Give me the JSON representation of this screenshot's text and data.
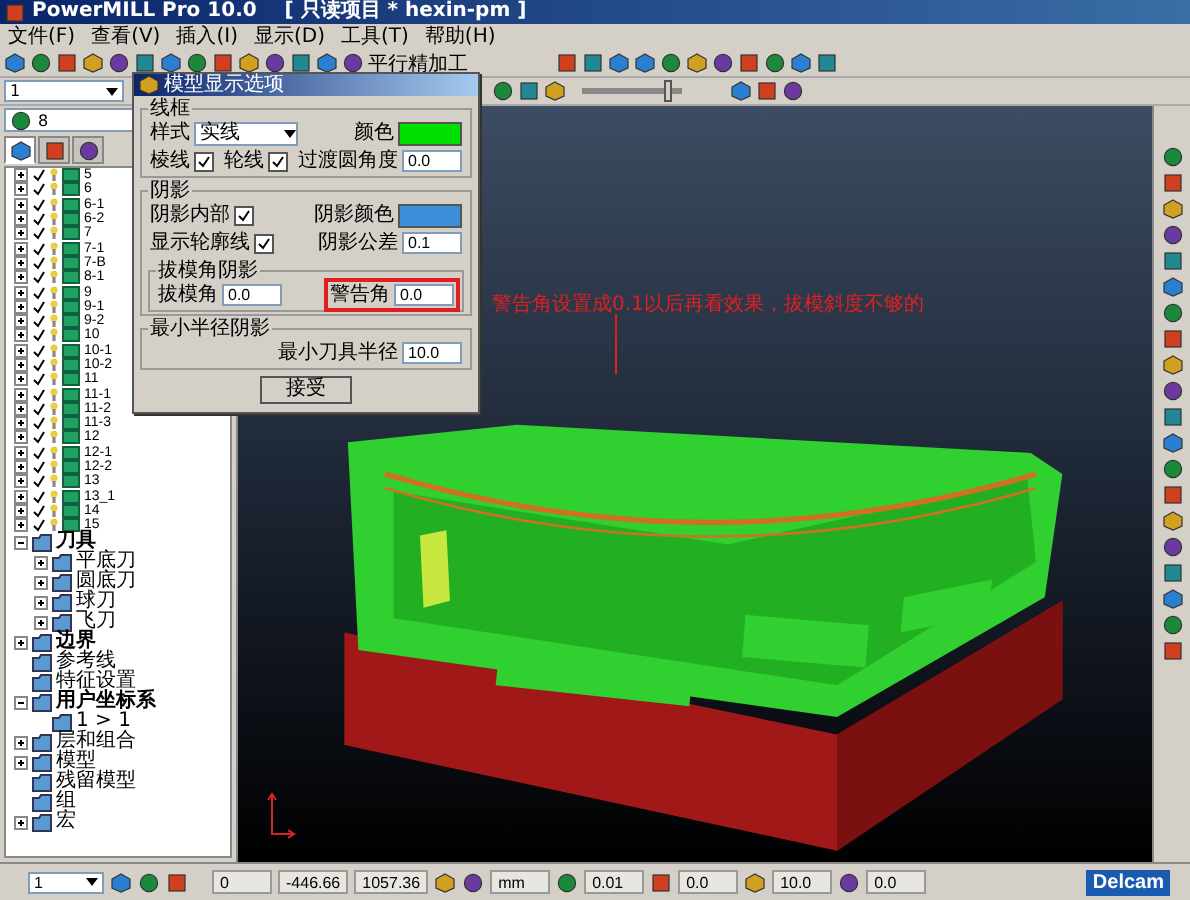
{
  "window": {
    "title": "PowerMILL Pro 10.0    [ 只读项目 * hexin-pm ]"
  },
  "menu": [
    "文件(F)",
    "查看(V)",
    "插入(I)",
    "显示(D)",
    "工具(T)",
    "帮助(H)"
  ],
  "toolbar": {
    "strategy_button": "平行精加工"
  },
  "toolbar2": {
    "dropdown": "1",
    "slider": {
      "level": 0.9
    }
  },
  "explorer": {
    "search_value": "8",
    "tabs": [
      {
        "selected": true
      },
      {
        "selected": false
      },
      {
        "selected": false
      }
    ],
    "tree": [
      {
        "kind": "part",
        "label": "5",
        "checked": true
      },
      {
        "kind": "part",
        "label": "6",
        "checked": true
      },
      {
        "kind": "part",
        "label": "6-1",
        "checked": true
      },
      {
        "kind": "part",
        "label": "6-2",
        "checked": true
      },
      {
        "kind": "part",
        "label": "7",
        "checked": true
      },
      {
        "kind": "part",
        "label": "7-1",
        "checked": true
      },
      {
        "kind": "part",
        "label": "7-B",
        "checked": true
      },
      {
        "kind": "part",
        "label": "8-1",
        "checked": true
      },
      {
        "kind": "part",
        "label": "9",
        "checked": true
      },
      {
        "kind": "part",
        "label": "9-1",
        "checked": true
      },
      {
        "kind": "part",
        "label": "9-2",
        "checked": true
      },
      {
        "kind": "part",
        "label": "10",
        "checked": true
      },
      {
        "kind": "part",
        "label": "10-1",
        "checked": true
      },
      {
        "kind": "part",
        "label": "10-2",
        "checked": true
      },
      {
        "kind": "part",
        "label": "11",
        "checked": true
      },
      {
        "kind": "part",
        "label": "11-1",
        "checked": true
      },
      {
        "kind": "part",
        "label": "11-2",
        "checked": true
      },
      {
        "kind": "part",
        "label": "11-3",
        "checked": true
      },
      {
        "kind": "part",
        "label": "12",
        "checked": true
      },
      {
        "kind": "part",
        "label": "12-1",
        "checked": true
      },
      {
        "kind": "part",
        "label": "12-2",
        "checked": true
      },
      {
        "kind": "part",
        "label": "13",
        "checked": true
      },
      {
        "kind": "part",
        "label": "13_1",
        "checked": true
      },
      {
        "kind": "part",
        "label": "14",
        "checked": true
      },
      {
        "kind": "part",
        "label": "15",
        "checked": true
      },
      {
        "kind": "folder",
        "label": "刀具",
        "bold": true,
        "expanded": true,
        "children": [
          {
            "kind": "folder",
            "label": "平底刀",
            "bold": false,
            "expanded": false
          },
          {
            "kind": "folder",
            "label": "圆底刀",
            "bold": false,
            "expanded": false
          },
          {
            "kind": "folder",
            "label": "球刀",
            "bold": false,
            "expanded": false
          },
          {
            "kind": "folder",
            "label": "飞刀",
            "bold": false,
            "expanded": false
          }
        ]
      },
      {
        "kind": "folder",
        "label": "边界",
        "bold": true,
        "expanded": false
      },
      {
        "kind": "leaf",
        "label": "参考线",
        "bold": false
      },
      {
        "kind": "leaf",
        "label": "特征设置",
        "bold": false
      },
      {
        "kind": "folder",
        "label": "用户坐标系",
        "bold": true,
        "expanded": true,
        "children": [
          {
            "kind": "leaf",
            "label": "1 > 1",
            "bold": false
          }
        ]
      },
      {
        "kind": "folder",
        "label": "层和组合",
        "bold": false,
        "expanded": false
      },
      {
        "kind": "folder",
        "label": "模型",
        "bold": false,
        "expanded": false
      },
      {
        "kind": "leaf",
        "label": "残留模型",
        "bold": false
      },
      {
        "kind": "leaf",
        "label": "组",
        "bold": false
      },
      {
        "kind": "folder",
        "label": "宏",
        "bold": false,
        "expanded": false
      }
    ]
  },
  "dialog": {
    "title": "模型显示选项",
    "groups": [
      {
        "title": "线框",
        "rows": [
          [
            {
              "kind": "select",
              "label": "样式",
              "value": "实线"
            },
            "",
            {
              "kind": "color",
              "label": "颜色",
              "color": "#00e000"
            }
          ],
          [
            {
              "kind": "check",
              "label": "棱线",
              "checked": true
            },
            {
              "kind": "check",
              "label": "轮线",
              "checked": true
            },
            {
              "kind": "number",
              "label": "过渡圆角度",
              "value": "0.0",
              "highlighted": false
            }
          ]
        ]
      },
      {
        "title": "阴影",
        "rows": [
          [
            {
              "kind": "check",
              "label": "阴影内部",
              "checked": true
            },
            {
              "kind": "color",
              "label": "阴影颜色",
              "color": "#3a8fd8"
            }
          ],
          [
            {
              "kind": "check",
              "label": "显示轮廓线",
              "checked": true
            },
            {
              "kind": "number",
              "label": "阴影公差",
              "value": "0.1",
              "highlighted": false
            }
          ]
        ],
        "subgroup": {
          "title": "拔模角阴影",
          "rows": [
            [
              {
                "kind": "number",
                "label": "拔模角",
                "value": "0.0",
                "highlighted": false
              },
              {
                "kind": "number",
                "label": "警告角",
                "value": "0.0",
                "highlighted": true
              }
            ]
          ]
        }
      },
      {
        "title": "最小半径阴影",
        "rows": [
          [
            {
              "kind": "number",
              "label": "最小刀具半径",
              "value": "10.0",
              "highlighted": false
            }
          ]
        ]
      }
    ],
    "button": "接受"
  },
  "annotation": "警告角设置成0.1以后再看效果，拔模斜度不够的",
  "status_bar": {
    "dropdown": "1",
    "fields": [
      "0",
      "-446.66",
      "1057.36"
    ],
    "unit": "mm",
    "values": [
      "0.01",
      "0.0",
      "10.0",
      "0.0"
    ],
    "logo": "Delcam"
  }
}
